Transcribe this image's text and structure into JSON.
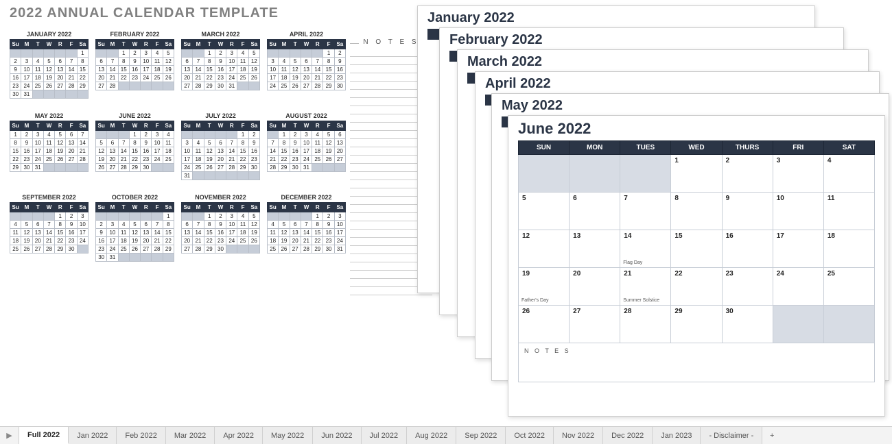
{
  "annual": {
    "title": "2022 ANNUAL CALENDAR TEMPLATE",
    "notes_label": "N O T E S",
    "day_short": [
      "Su",
      "M",
      "T",
      "W",
      "R",
      "F",
      "Sa"
    ],
    "months": [
      {
        "name": "JANUARY 2022",
        "start": 6,
        "days": 31
      },
      {
        "name": "FEBRUARY 2022",
        "start": 2,
        "days": 28
      },
      {
        "name": "MARCH 2022",
        "start": 2,
        "days": 31
      },
      {
        "name": "APRIL 2022",
        "start": 5,
        "days": 30
      },
      {
        "name": "MAY 2022",
        "start": 0,
        "days": 31
      },
      {
        "name": "JUNE 2022",
        "start": 3,
        "days": 30
      },
      {
        "name": "JULY 2022",
        "start": 5,
        "days": 31
      },
      {
        "name": "AUGUST 2022",
        "start": 1,
        "days": 31
      },
      {
        "name": "SEPTEMBER 2022",
        "start": 4,
        "days": 30
      },
      {
        "name": "OCTOBER 2022",
        "start": 6,
        "days": 31
      },
      {
        "name": "NOVEMBER 2022",
        "start": 2,
        "days": 30
      },
      {
        "name": "DECEMBER 2022",
        "start": 4,
        "days": 31
      }
    ]
  },
  "stack": {
    "pages": [
      {
        "title": "January 2022"
      },
      {
        "title": "February 2022"
      },
      {
        "title": "March 2022"
      },
      {
        "title": "April 2022"
      },
      {
        "title": "May 2022"
      }
    ],
    "day_full": [
      "SUN",
      "MON",
      "TUES",
      "WED",
      "THURS",
      "FRI",
      "SAT"
    ],
    "front": {
      "title": "June 2022",
      "start": 3,
      "days": 30,
      "notes_label": "N O T E S",
      "events": {
        "14": "Flag Day",
        "19": "Father's Day",
        "21": "Summer Solstice"
      }
    }
  },
  "tabs": {
    "scroll_glyph": "▶",
    "add_glyph": "+",
    "active_index": 0,
    "items": [
      "Full 2022",
      "Jan 2022",
      "Feb 2022",
      "Mar 2022",
      "Apr 2022",
      "May 2022",
      "Jun 2022",
      "Jul 2022",
      "Aug 2022",
      "Sep 2022",
      "Oct 2022",
      "Nov 2022",
      "Dec 2022",
      "Jan 2023",
      "- Disclaimer -"
    ]
  }
}
